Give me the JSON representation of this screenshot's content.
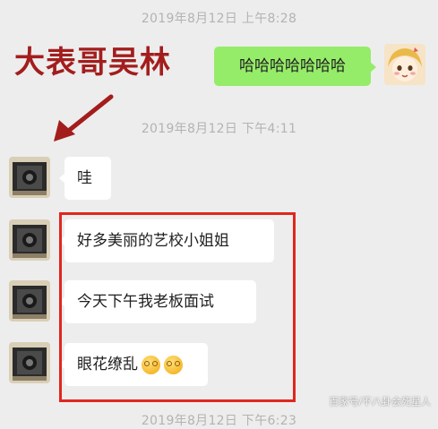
{
  "timestamps": {
    "first": "2019年8月12日 上午8:28",
    "second": "2019年8月12日 下午4:11",
    "third": "2019年8月12日 下午6:23"
  },
  "annotation": {
    "label": "大表哥吴林"
  },
  "messages": {
    "self_1": "哈哈哈哈哈哈哈",
    "friend_1": "哇",
    "friend_2": "好多美丽的艺校小姐姐",
    "friend_3": "今天下午我老板面试",
    "friend_4": "眼花缭乱"
  },
  "emoji_icons": [
    "flushed-face-icon",
    "flushed-face-icon"
  ],
  "highlight_color": "#e0261f",
  "annotation_color": "#a31d1d",
  "bubble_colors": {
    "self": "#95ec69",
    "friend": "#ffffff"
  },
  "watermark": "百家号/不八卦会死星人"
}
